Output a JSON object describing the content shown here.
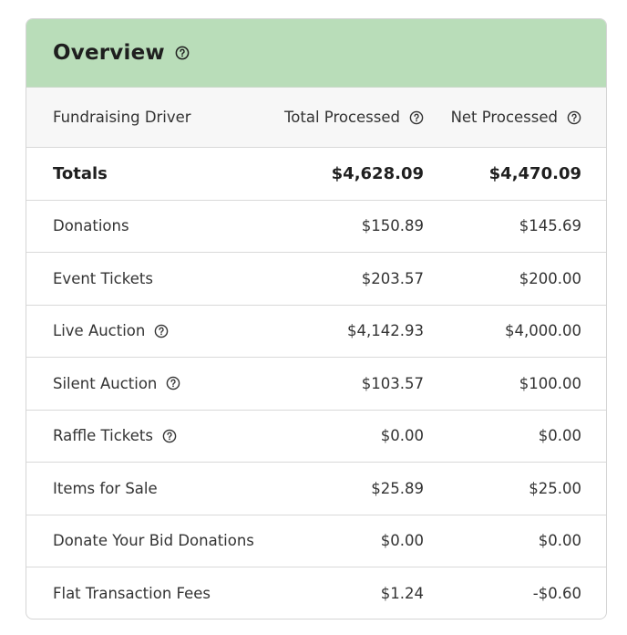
{
  "header": {
    "title": "Overview",
    "help_icon": "question-circle-icon",
    "background_color": "#b9ddb9"
  },
  "columns": {
    "driver": "Fundraising Driver",
    "total": "Total Processed",
    "net": "Net Processed"
  },
  "totals": {
    "label": "Totals",
    "total": "$4,628.09",
    "net": "$4,470.09"
  },
  "rows": [
    {
      "label": "Donations",
      "total": "$150.89",
      "net": "$145.69",
      "has_help": false
    },
    {
      "label": "Event Tickets",
      "total": "$203.57",
      "net": "$200.00",
      "has_help": false
    },
    {
      "label": "Live Auction",
      "total": "$4,142.93",
      "net": "$4,000.00",
      "has_help": true
    },
    {
      "label": "Silent Auction",
      "total": "$103.57",
      "net": "$100.00",
      "has_help": true
    },
    {
      "label": "Raffle Tickets",
      "total": "$0.00",
      "net": "$0.00",
      "has_help": true
    },
    {
      "label": "Items for Sale",
      "total": "$25.89",
      "net": "$25.00",
      "has_help": false
    },
    {
      "label": "Donate Your Bid Donations",
      "total": "$0.00",
      "net": "$0.00",
      "has_help": false
    },
    {
      "label": "Flat Transaction Fees",
      "total": "$1.24",
      "net": "-$0.60",
      "has_help": false
    }
  ]
}
